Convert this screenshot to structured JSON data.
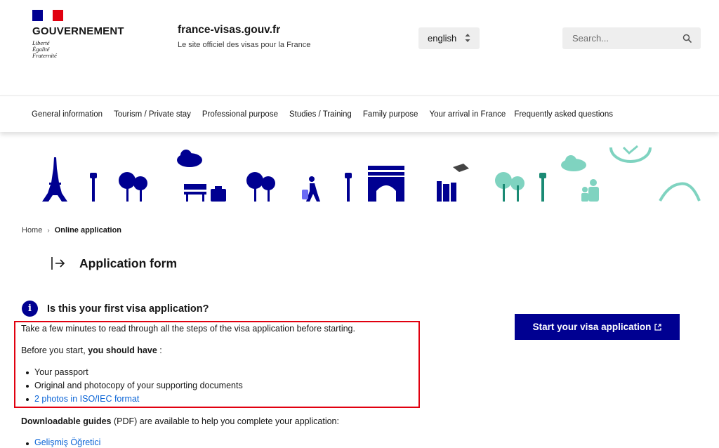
{
  "header": {
    "gov_name": "GOUVERNEMENT",
    "motto": [
      "Liberté",
      "Égalité",
      "Fraternité"
    ],
    "site_title": "france-visas.gouv.fr",
    "site_subtitle": "Le site officiel des visas pour la France",
    "language": "english",
    "search_placeholder": "Search..."
  },
  "nav": {
    "items": [
      "General information",
      "Tourism / Private stay",
      "Professional purpose",
      "Studies / Training",
      "Family purpose",
      "Your arrival in France",
      "Frequently asked questions"
    ]
  },
  "breadcrumb": {
    "home": "Home",
    "current": "Online application"
  },
  "page_title": "Application form",
  "info": {
    "heading": "Is this your first visa application?",
    "intro": "Take a few minutes to read through all the steps of the visa application before starting.",
    "before_prefix": "Before you start, ",
    "before_bold": "you should have",
    "before_suffix": " :",
    "items": [
      "Your passport",
      "Original and photocopy of your supporting documents"
    ],
    "link_item": "2 photos in ISO/IEC format"
  },
  "guides": {
    "bold": "Downloadable guides",
    "text": " (PDF) are available to help you complete your application:",
    "items": [
      "Gelişmiş Öğretici"
    ]
  },
  "start_button": "Start your visa application",
  "colors": {
    "brand_blue": "#000091",
    "flag_red": "#e1000f",
    "illustration_teal": "#7fd3c0",
    "link_blue": "#0a64d6"
  }
}
